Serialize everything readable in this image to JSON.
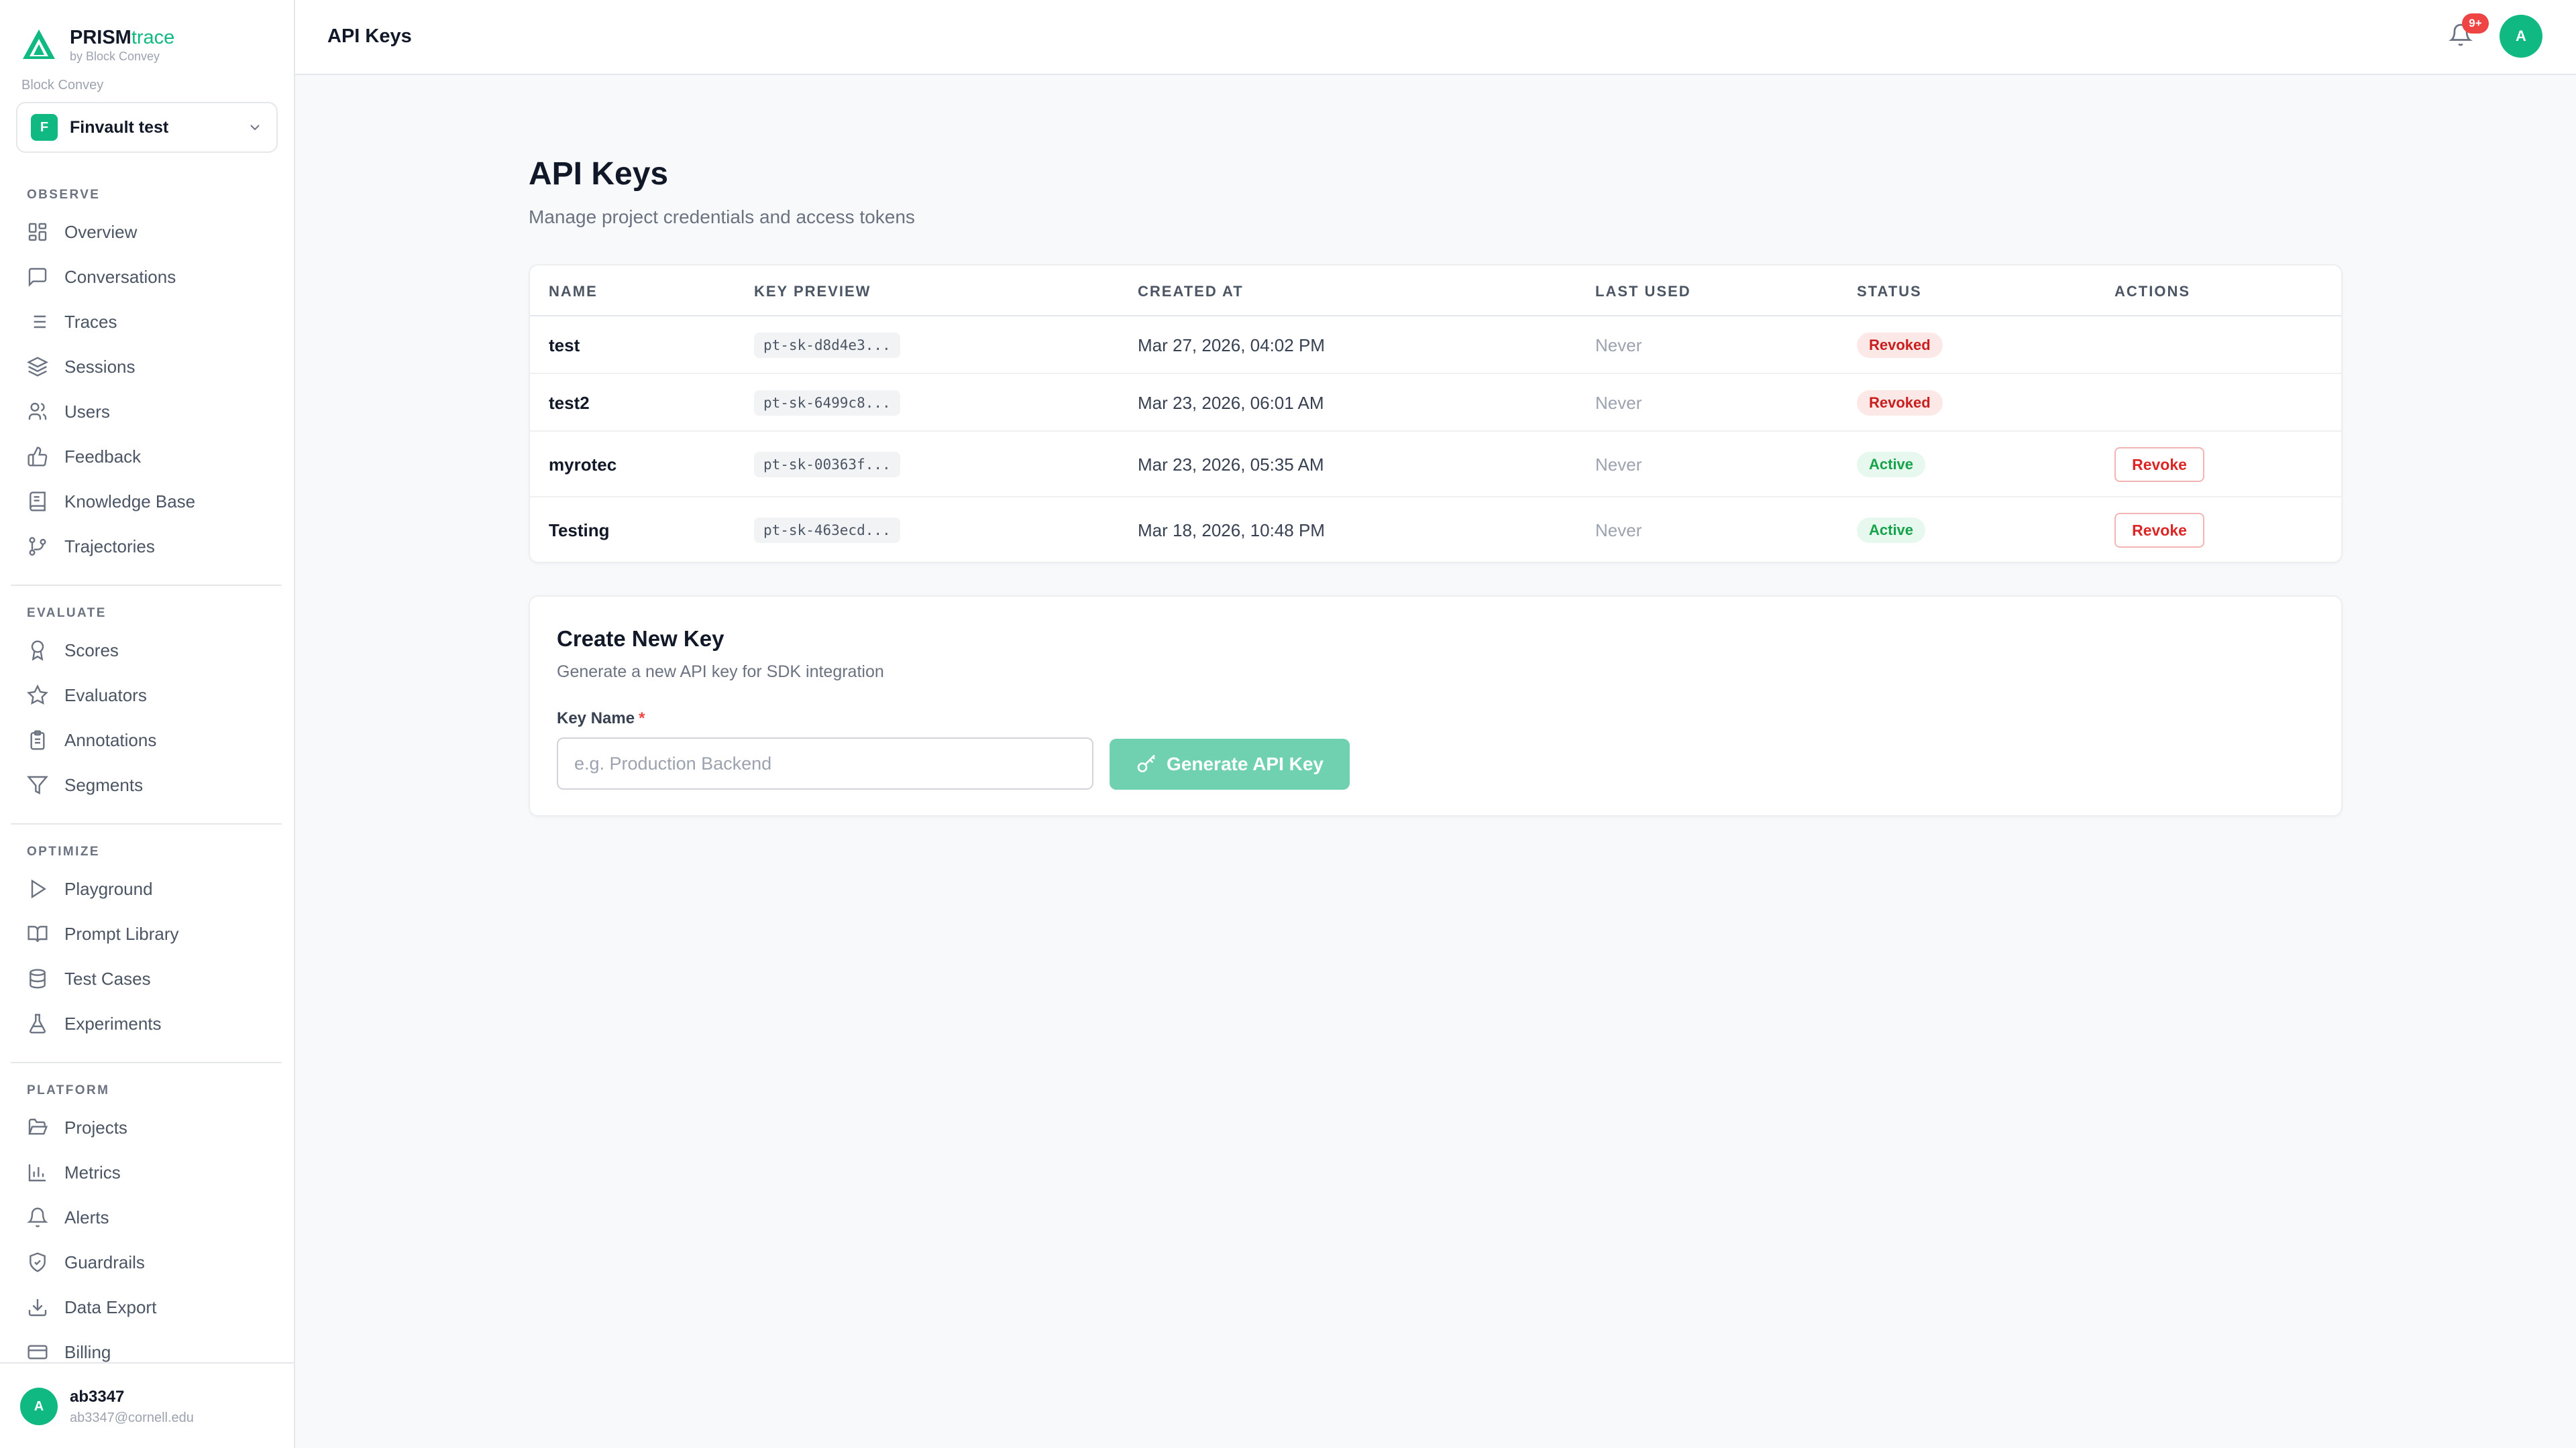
{
  "brand": {
    "name_prefix": "PRISM",
    "name_suffix": "trace",
    "subtitle": "by Block Convey"
  },
  "org": {
    "label": "Block Convey"
  },
  "project": {
    "badge": "F",
    "name": "Finvault test"
  },
  "sidebar": {
    "sections": [
      {
        "label": "OBSERVE",
        "items": [
          "Overview",
          "Conversations",
          "Traces",
          "Sessions",
          "Users",
          "Feedback",
          "Knowledge Base",
          "Trajectories"
        ]
      },
      {
        "label": "EVALUATE",
        "items": [
          "Scores",
          "Evaluators",
          "Annotations",
          "Segments"
        ]
      },
      {
        "label": "OPTIMIZE",
        "items": [
          "Playground",
          "Prompt Library",
          "Test Cases",
          "Experiments"
        ]
      },
      {
        "label": "PLATFORM",
        "items": [
          "Projects",
          "Metrics",
          "Alerts",
          "Guardrails",
          "Data Export",
          "Billing"
        ]
      }
    ]
  },
  "user": {
    "initial": "A",
    "name": "ab3347",
    "email": "ab3347@cornell.edu"
  },
  "topbar": {
    "title": "API Keys",
    "notification_count": "9+",
    "avatar_initial": "A"
  },
  "page": {
    "title": "API Keys",
    "subtitle": "Manage project credentials and access tokens"
  },
  "table": {
    "headers": [
      "NAME",
      "KEY PREVIEW",
      "CREATED AT",
      "LAST USED",
      "STATUS",
      "ACTIONS"
    ],
    "rows": [
      {
        "name": "test",
        "key": "pt-sk-d8d4e3...",
        "created": "Mar 27, 2026, 04:02 PM",
        "last_used": "Never",
        "status": "Revoked",
        "action": ""
      },
      {
        "name": "test2",
        "key": "pt-sk-6499c8...",
        "created": "Mar 23, 2026, 06:01 AM",
        "last_used": "Never",
        "status": "Revoked",
        "action": ""
      },
      {
        "name": "myrotec",
        "key": "pt-sk-00363f...",
        "created": "Mar 23, 2026, 05:35 AM",
        "last_used": "Never",
        "status": "Active",
        "action": "Revoke"
      },
      {
        "name": "Testing",
        "key": "pt-sk-463ecd...",
        "created": "Mar 18, 2026, 10:48 PM",
        "last_used": "Never",
        "status": "Active",
        "action": "Revoke"
      }
    ]
  },
  "create": {
    "title": "Create New Key",
    "subtitle": "Generate a new API key for SDK integration",
    "label": "Key Name",
    "required_mark": "*",
    "placeholder": "e.g. Production Backend",
    "value": "",
    "button": "Generate API Key"
  },
  "colors": {
    "accent": "#10b981",
    "danger": "#dc2626",
    "success": "#16a34a",
    "button": "#6fd1b0"
  }
}
